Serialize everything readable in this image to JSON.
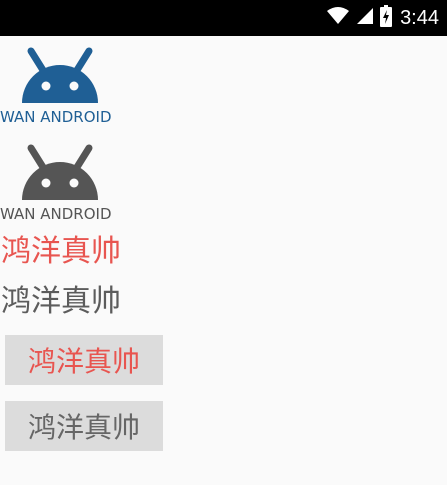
{
  "status_bar": {
    "time": "3:44",
    "icons": [
      "wifi-icon",
      "cell-signal-icon",
      "battery-icon"
    ]
  },
  "logos": [
    {
      "text": "WAN ANDROID",
      "color": "#1f5f95"
    },
    {
      "text": "WAN ANDROID",
      "color": "#555555"
    }
  ],
  "texts": [
    {
      "label": "鸿洋真帅",
      "color": "#e85550"
    },
    {
      "label": "鸿洋真帅",
      "color": "#5c5c5c"
    }
  ],
  "buttons": [
    {
      "label": "鸿洋真帅",
      "color": "#e85550"
    },
    {
      "label": "鸿洋真帅",
      "color": "#666666"
    }
  ]
}
